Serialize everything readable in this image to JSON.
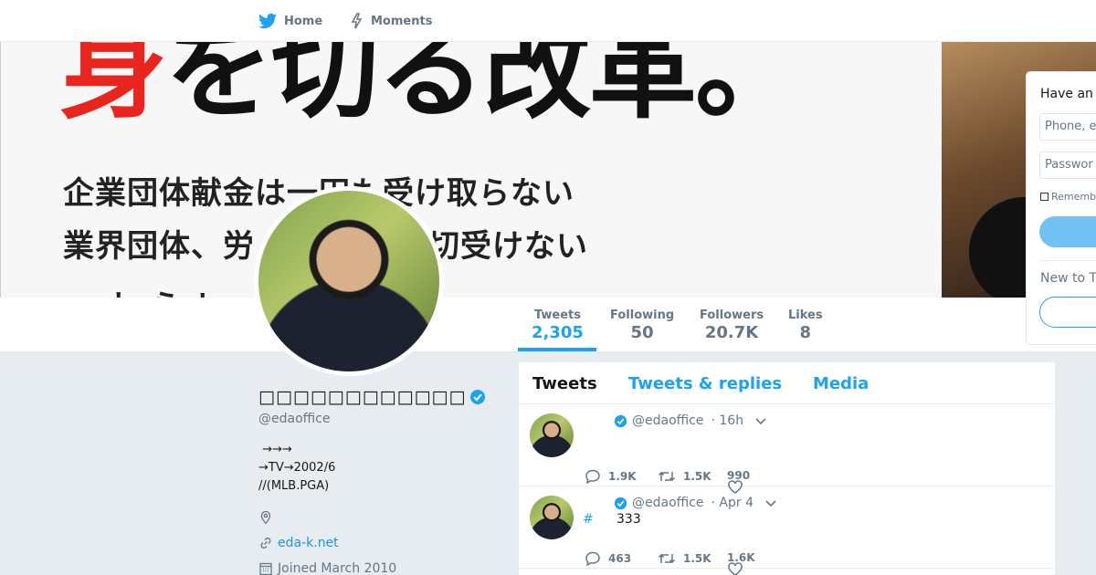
{
  "nav": {
    "home_label": "Home",
    "moments_label": "Moments"
  },
  "banner": {
    "headline_red": "身",
    "headline_rest": "を切る改革。",
    "line1": "企業団体献金は一円も受け取らない",
    "line2": "業界団体、労",
    "line2_tail": "は一切受けない",
    "line3": "ー ト ら レ ． 「 ． ‥ 。"
  },
  "stats": {
    "tweets_label": "Tweets",
    "tweets_value": "2,305",
    "following_label": "Following",
    "following_value": "50",
    "followers_label": "Followers",
    "followers_value": "20.7K",
    "likes_label": "Likes",
    "likes_value": "8"
  },
  "profile": {
    "name": "□□□□□□□□□□□□",
    "handle": "@edaoffice",
    "bio_line1": " →→→",
    "bio_line2": "→TV→2002/6",
    "bio_line3": "//(MLB.PGA)",
    "location": "",
    "url": "eda-k.net",
    "joined": "Joined March 2010"
  },
  "timeline": {
    "tabs": [
      "Tweets",
      "Tweets & replies",
      "Media"
    ],
    "tweets": [
      {
        "handle": "@edaoffice",
        "time": "· 16h",
        "hash": "",
        "text": "",
        "replies": "1.9K",
        "retweets": "1.5K",
        "likes": "990"
      },
      {
        "handle": "@edaoffice",
        "time": "· Apr 4",
        "hash": "#",
        "text": "333",
        "replies": "463",
        "retweets": "1.5K",
        "likes": "1.6K"
      }
    ]
  },
  "login": {
    "title": "Have an",
    "phone_placeholder": "Phone, e",
    "password_placeholder": "Passwor",
    "remember_label": "Rememb",
    "new_label": "New to T"
  },
  "colors": {
    "accent": "#1da1f2",
    "banner_red": "#e8261d"
  }
}
